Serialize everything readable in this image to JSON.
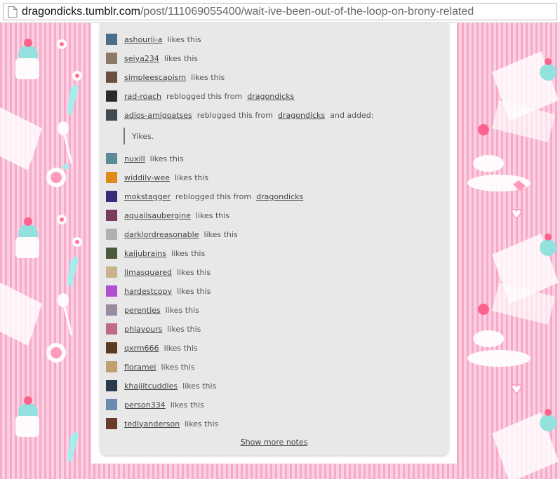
{
  "address_bar": {
    "host": "dragondicks.tumblr.com",
    "path": "/post/111069055400/wait-ive-been-out-of-the-loop-on-brony-related"
  },
  "notes": [
    {
      "user": "ashourii-a",
      "action": "likes this",
      "source": "",
      "avatar_color": "#4a6f8a"
    },
    {
      "user": "seiya234",
      "action": "likes this",
      "source": "",
      "avatar_color": "#8a7a68"
    },
    {
      "user": "simpleescapism",
      "action": "likes this",
      "source": "",
      "avatar_color": "#6b5040"
    },
    {
      "user": "rad-roach",
      "action": "reblogged this from",
      "source": "dragondicks",
      "avatar_color": "#2b2a25"
    },
    {
      "user": "adios-amigoatses",
      "action": "reblogged this from",
      "source": "dragondicks",
      "suffix": "and added:",
      "avatar_color": "#3d4a50"
    },
    {
      "user": "nuxill",
      "action": "likes this",
      "source": "",
      "avatar_color": "#5c8a9a"
    },
    {
      "user": "widdily-wee",
      "action": "likes this",
      "source": "",
      "avatar_color": "#e08a1a"
    },
    {
      "user": "mokstagger",
      "action": "reblogged this from",
      "source": "dragondicks",
      "avatar_color": "#3a2a7a"
    },
    {
      "user": "aquailsaubergine",
      "action": "likes this",
      "source": "",
      "avatar_color": "#7a3a5a"
    },
    {
      "user": "darklordreasonable",
      "action": "likes this",
      "source": "",
      "avatar_color": "#b0b0b0"
    },
    {
      "user": "kaijubrains",
      "action": "likes this",
      "source": "",
      "avatar_color": "#4a5a3a"
    },
    {
      "user": "limasquared",
      "action": "likes this",
      "source": "",
      "avatar_color": "#c8b48a"
    },
    {
      "user": "hardestcopy",
      "action": "likes this",
      "source": "",
      "avatar_color": "#b050d0"
    },
    {
      "user": "perenties",
      "action": "likes this",
      "source": "",
      "avatar_color": "#9a8aa0"
    },
    {
      "user": "phlavours",
      "action": "likes this",
      "source": "",
      "avatar_color": "#c06a8a"
    },
    {
      "user": "qxrm666",
      "action": "likes this",
      "source": "",
      "avatar_color": "#5a3a20"
    },
    {
      "user": "floramei",
      "action": "likes this",
      "source": "",
      "avatar_color": "#c0a070"
    },
    {
      "user": "khajiitcuddles",
      "action": "likes this",
      "source": "",
      "avatar_color": "#2a3a4a"
    },
    {
      "user": "person334",
      "action": "likes this",
      "source": "",
      "avatar_color": "#6a8ab0"
    },
    {
      "user": "tedlyanderson",
      "action": "likes this",
      "source": "",
      "avatar_color": "#6a3a2a"
    }
  ],
  "quote_text": "Yikes.",
  "show_more": "Show more notes"
}
